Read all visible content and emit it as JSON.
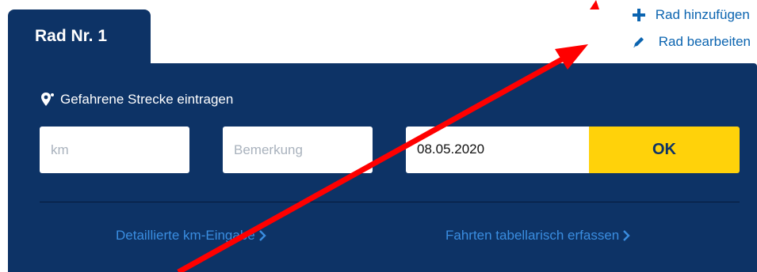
{
  "header_actions": {
    "add_label": "Rad hinzufügen",
    "edit_label": "Rad bearbeiten",
    "add_icon": "plus-icon",
    "edit_icon": "pencil-icon"
  },
  "tab": {
    "label": "Rad Nr. 1"
  },
  "entry": {
    "section_icon": "route-pin-icon",
    "section_title": "Gefahrene Strecke eintragen",
    "km_placeholder": "km",
    "note_placeholder": "Bemerkung",
    "date_value": "08.05.2020",
    "ok_label": "OK"
  },
  "links": {
    "detail_km": "Detaillierte km-Eingabe",
    "table_entry": "Fahrten tabellarisch erfassen"
  },
  "colors": {
    "panel": "#0d3366",
    "accent_yellow": "#ffd20a",
    "link_blue": "#3a8de0",
    "action_blue": "#0b64b0",
    "annotation_red": "#ff0000"
  }
}
